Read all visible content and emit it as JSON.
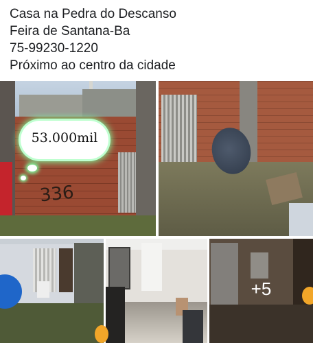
{
  "post": {
    "lines": [
      "Casa na Pedra do Descanso",
      "Feira de Santana-Ba",
      "75-99230-1220",
      "Próximo ao centro da cidade"
    ]
  },
  "gallery": {
    "photos": [
      {
        "description_icon": "photo",
        "price_sticker": "53.000mil",
        "graffiti": "336"
      },
      {
        "description_icon": "photo"
      },
      {
        "description_icon": "photo"
      },
      {
        "description_icon": "photo"
      },
      {
        "description_icon": "photo"
      }
    ],
    "more_count": "+5"
  },
  "colors": {
    "text": "#1c1e21",
    "sticker_glow": "#7dffa0",
    "overlay_text": "#ffffff"
  }
}
